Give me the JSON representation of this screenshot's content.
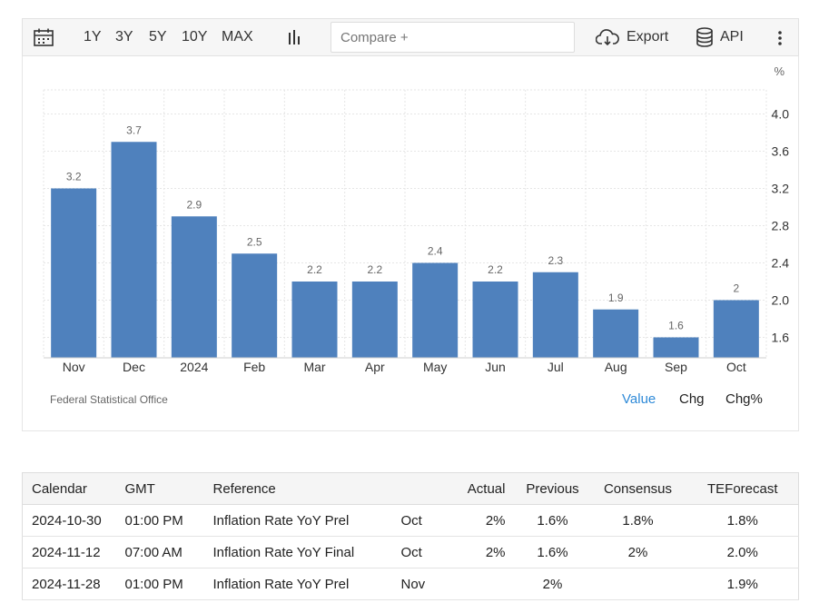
{
  "toolbar": {
    "ranges": [
      "1Y",
      "3Y",
      "5Y",
      "10Y",
      "MAX"
    ],
    "compare_placeholder": "Compare +",
    "export_label": "Export",
    "api_label": "API"
  },
  "chart_data": {
    "type": "bar",
    "title": "",
    "xlabel": "",
    "ylabel": "",
    "unit_label": "%",
    "categories": [
      "Nov",
      "Dec",
      "2024",
      "Feb",
      "Mar",
      "Apr",
      "May",
      "Jun",
      "Jul",
      "Aug",
      "Sep",
      "Oct"
    ],
    "values": [
      3.2,
      3.7,
      2.9,
      2.5,
      2.2,
      2.2,
      2.4,
      2.2,
      2.3,
      1.9,
      1.6,
      2.0
    ],
    "value_labels": [
      "3.2",
      "3.7",
      "2.9",
      "2.5",
      "2.2",
      "2.2",
      "2.4",
      "2.2",
      "2.3",
      "1.9",
      "1.6",
      "2"
    ],
    "yticks": [
      "4.0",
      "3.6",
      "3.2",
      "2.8",
      "2.4",
      "2.0",
      "1.6"
    ],
    "ylim": [
      1.4,
      4.3
    ],
    "y_axis_side": "right",
    "grid": true,
    "bar_color": "#4f81bd"
  },
  "source": "Federal Statistical Office",
  "view_tabs": {
    "value": "Value",
    "chg": "Chg",
    "chgpct": "Chg%",
    "active_color": "#2f8ad8"
  },
  "table": {
    "headers": [
      "Calendar",
      "GMT",
      "Reference",
      "",
      "Actual",
      "Previous",
      "Consensus",
      "TEForecast"
    ],
    "rows": [
      [
        "2024-10-30",
        "01:00 PM",
        "Inflation Rate YoY Prel",
        "Oct",
        "2%",
        "1.6%",
        "1.8%",
        "1.8%"
      ],
      [
        "2024-11-12",
        "07:00 AM",
        "Inflation Rate YoY Final",
        "Oct",
        "2%",
        "1.6%",
        "2%",
        "2.0%"
      ],
      [
        "2024-11-28",
        "01:00 PM",
        "Inflation Rate YoY Prel",
        "Nov",
        "",
        "2%",
        "",
        "1.9%"
      ]
    ]
  }
}
